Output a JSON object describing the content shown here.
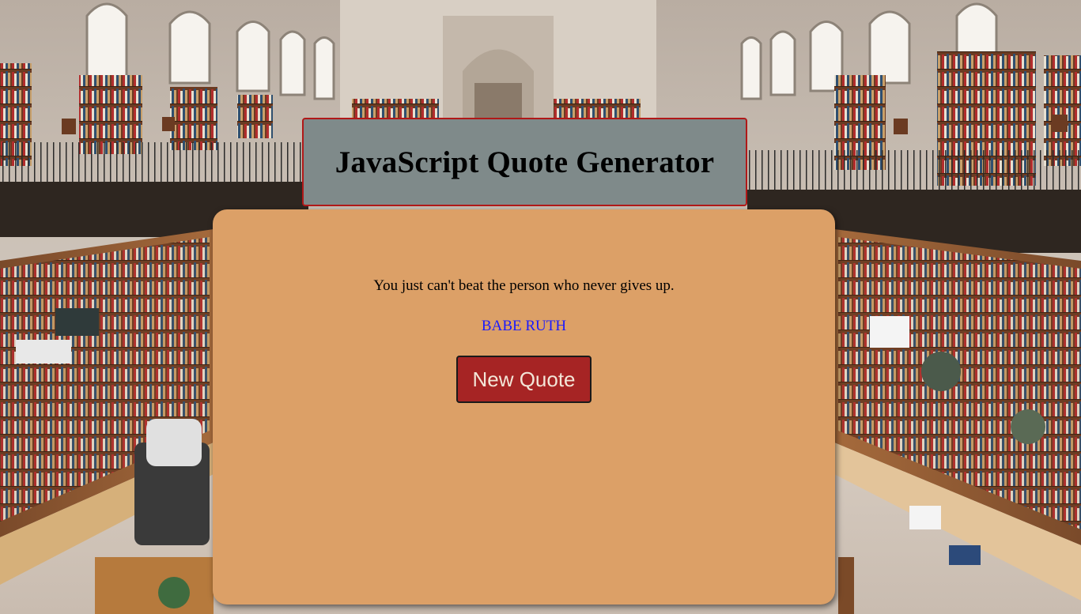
{
  "header": {
    "title": "JavaScript Quote Generator"
  },
  "quote": {
    "text": "You just can't beat the person who never gives up.",
    "author": "BABE RUTH"
  },
  "actions": {
    "new_quote_label": "New Quote"
  },
  "colors": {
    "title_background": "#7f8a8a",
    "title_border": "#b01818",
    "card_background": "#dca067",
    "author_text": "#1a1aff",
    "button_background": "#a62424",
    "button_text": "#f3e6d8"
  }
}
